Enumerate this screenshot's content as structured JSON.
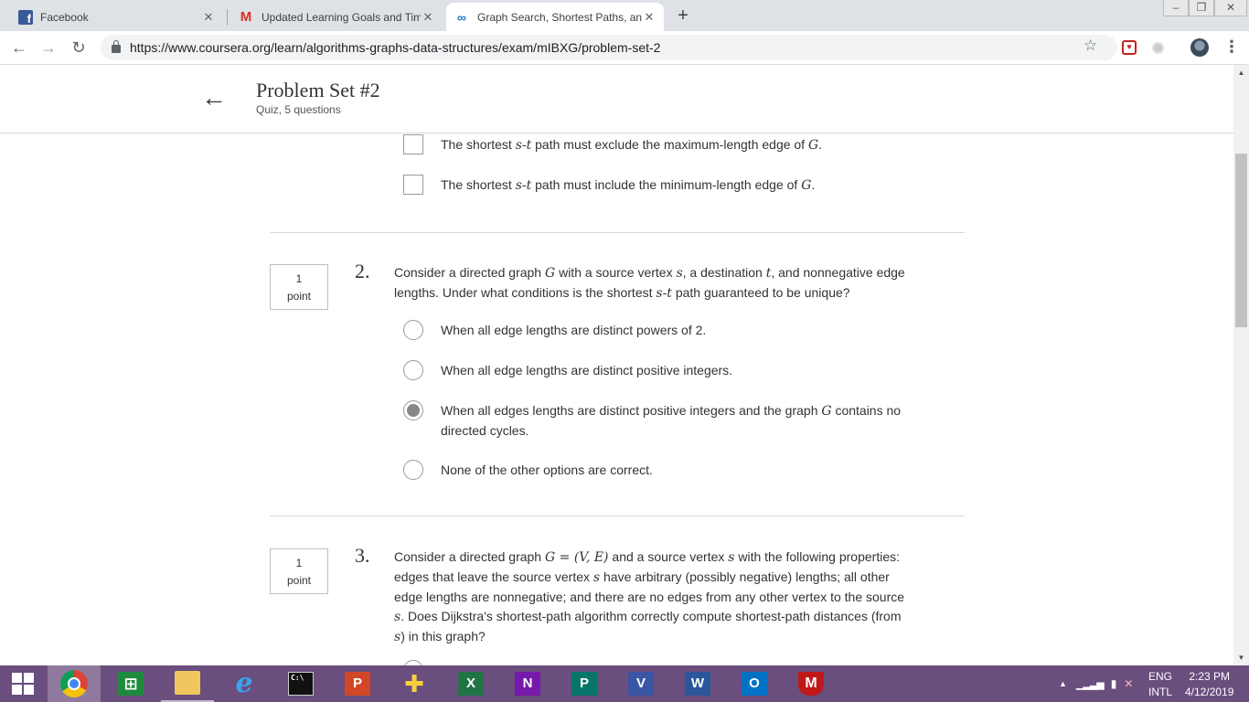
{
  "browser": {
    "tabs": [
      {
        "title": "Facebook",
        "icon": "facebook-icon"
      },
      {
        "title": "Updated Learning Goals and Tim",
        "icon": "gmail-icon"
      },
      {
        "title": "Graph Search, Shortest Paths, an",
        "icon": "coursera-icon",
        "active": true
      }
    ],
    "tab_close": "✕",
    "new_tab": "+",
    "url": "https://www.coursera.org/learn/algorithms-graphs-data-structures/exam/mIBXG/problem-set-2"
  },
  "header": {
    "back": "←",
    "title": "Problem Set #2",
    "subtitle": "Quiz, 5 questions"
  },
  "q1_tail": {
    "options": [
      {
        "pre": "The shortest ",
        "math": "s-t",
        "mid": " path must exclude the maximum-length edge of ",
        "math2": "G",
        "post": "."
      },
      {
        "pre": "The shortest ",
        "math": "s-t",
        "mid": " path must include the minimum-length edge of ",
        "math2": "G",
        "post": "."
      }
    ]
  },
  "q2": {
    "points_value": "1",
    "points_label": "point",
    "number": "2.",
    "text": {
      "a": "Consider a directed graph ",
      "m1": "G",
      "b": " with a source vertex ",
      "m2": "s",
      "c": ", a destination ",
      "m3": "t",
      "d": ", and nonnegative edge lengths. Under what conditions is the shortest ",
      "m4": "s-t",
      "e": " path guaranteed to be unique?"
    },
    "options": [
      {
        "text": "When all edge lengths are distinct powers of 2.",
        "selected": false
      },
      {
        "text": "When all edge lengths are distinct positive integers.",
        "selected": false
      },
      {
        "pre": "When all edges lengths are distinct positive integers and the graph ",
        "math": "G",
        "post": " contains no directed cycles.",
        "selected": true
      },
      {
        "text": "None of the other options are correct.",
        "selected": false
      }
    ]
  },
  "q3": {
    "points_value": "1",
    "points_label": "point",
    "number": "3.",
    "text": {
      "a": "Consider a directed graph ",
      "m1": "G = (V, E)",
      "b": " and a source vertex ",
      "m2": "s",
      "c": " with the following properties: edges that leave the source vertex ",
      "m3": "s",
      "d": " have arbitrary (possibly negative) lengths; all other edge lengths are nonnegative; and there are no edges from any other vertex to the source ",
      "m4": "s",
      "e": ". Does Dijkstra's shortest-path algorithm correctly compute shortest-path distances (from ",
      "m5": "s",
      "f": ") in this graph?"
    }
  },
  "taskbar": {
    "language": "ENG",
    "layout": "INTL",
    "time": "2:23 PM",
    "date": "4/12/2019",
    "apps": [
      {
        "name": "chrome",
        "letter": ""
      },
      {
        "name": "store",
        "letter": ""
      },
      {
        "name": "file-explorer",
        "letter": ""
      },
      {
        "name": "internet-explorer",
        "letter": "e"
      },
      {
        "name": "command-prompt",
        "letter": "C:\\"
      },
      {
        "name": "powerpoint",
        "letter": "P"
      },
      {
        "name": "game",
        "letter": ""
      },
      {
        "name": "excel",
        "letter": "X"
      },
      {
        "name": "onenote",
        "letter": "N"
      },
      {
        "name": "publisher",
        "letter": "P"
      },
      {
        "name": "visio",
        "letter": "V"
      },
      {
        "name": "word",
        "letter": "W"
      },
      {
        "name": "outlook",
        "letter": "O"
      },
      {
        "name": "mcafee",
        "letter": ""
      }
    ]
  },
  "colors": {
    "taskbar": "#6a4e7e",
    "tab_strip": "#dee1e6",
    "powerpoint": "#d24726",
    "excel": "#217346",
    "onenote": "#7719aa",
    "publisher": "#077568",
    "visio": "#3955a3",
    "word": "#2b579a",
    "outlook": "#0072c6",
    "mcafee": "#c01818"
  }
}
